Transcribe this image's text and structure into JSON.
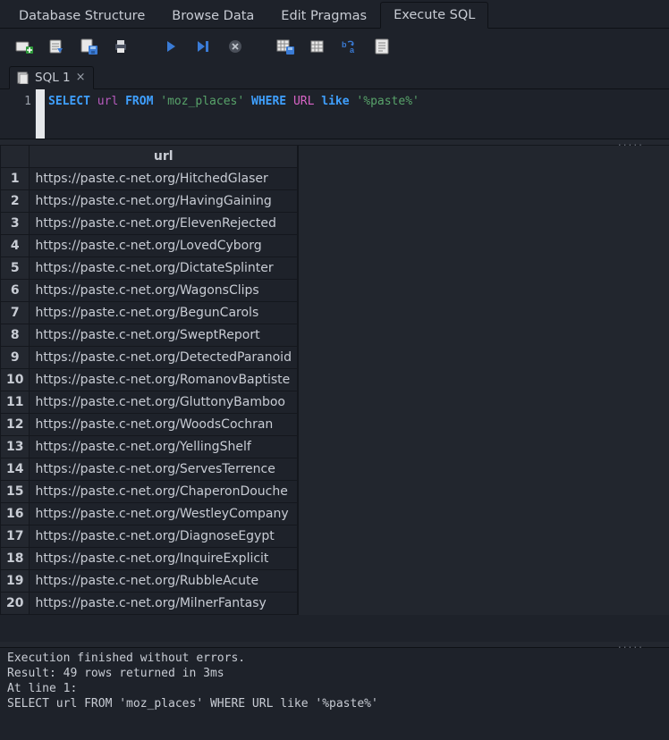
{
  "main_tabs": {
    "items": [
      {
        "label": "Database Structure",
        "active": false
      },
      {
        "label": "Browse Data",
        "active": false
      },
      {
        "label": "Edit Pragmas",
        "active": false
      },
      {
        "label": "Execute SQL",
        "active": true
      }
    ]
  },
  "toolbar_icons": [
    "new-tab-icon",
    "open-sql-icon",
    "save-sql-icon",
    "print-icon",
    "run-icon",
    "run-line-icon",
    "stop-icon",
    "save-results-icon",
    "export-csv-icon",
    "find-replace-icon",
    "text-icon"
  ],
  "file_tabs": {
    "items": [
      {
        "label": "SQL 1",
        "active": true
      }
    ]
  },
  "editor": {
    "line_number": "1",
    "tokens": {
      "select": "SELECT",
      "col": "url",
      "from": "FROM",
      "tbl": "'moz_places'",
      "where": "WHERE",
      "urlid": "URL",
      "like": "like",
      "pat": "'%paste%'"
    }
  },
  "results": {
    "column_header": "url",
    "rows": [
      "https://paste.c-net.org/HitchedGlaser",
      "https://paste.c-net.org/HavingGaining",
      "https://paste.c-net.org/ElevenRejected",
      "https://paste.c-net.org/LovedCyborg",
      "https://paste.c-net.org/DictateSplinter",
      "https://paste.c-net.org/WagonsClips",
      "https://paste.c-net.org/BegunCarols",
      "https://paste.c-net.org/SweptReport",
      "https://paste.c-net.org/DetectedParanoid",
      "https://paste.c-net.org/RomanovBaptiste",
      "https://paste.c-net.org/GluttonyBamboo",
      "https://paste.c-net.org/WoodsCochran",
      "https://paste.c-net.org/YellingShelf",
      "https://paste.c-net.org/ServesTerrence",
      "https://paste.c-net.org/ChaperonDouche",
      "https://paste.c-net.org/WestleyCompany",
      "https://paste.c-net.org/DiagnoseEgypt",
      "https://paste.c-net.org/InquireExplicit",
      "https://paste.c-net.org/RubbleAcute",
      "https://paste.c-net.org/MilnerFantasy"
    ]
  },
  "status": {
    "line1": "Execution finished without errors.",
    "line2": "Result: 49 rows returned in 3ms",
    "line3": "At line 1:",
    "line4": "SELECT url FROM 'moz_places' WHERE URL like '%paste%'"
  }
}
